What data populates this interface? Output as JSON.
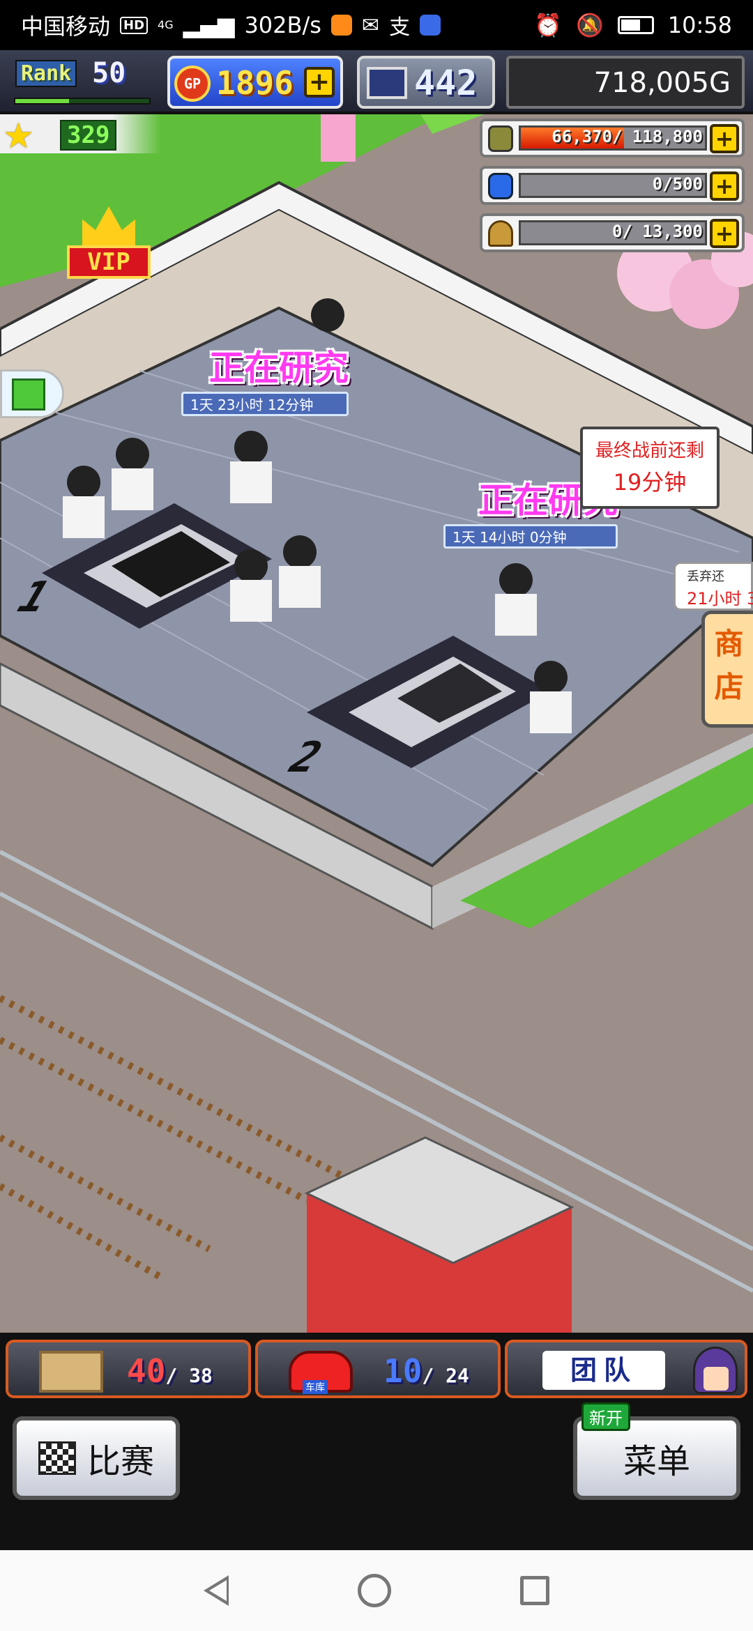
{
  "status_bar": {
    "carrier": "中国移动",
    "hd": "HD",
    "network": "4G",
    "speed": "302B/s",
    "time": "10:58"
  },
  "hud": {
    "rank_label": "Rank",
    "rank_value": "50",
    "rank_progress": 0.4,
    "gp_label": "GP",
    "gp_value": "1896",
    "research_points": "442",
    "money": "718,005G",
    "star_level": "329"
  },
  "resources": [
    {
      "icon": "fuel-barrel-icon",
      "text": "66,370/ 118,800",
      "fill": 0.56
    },
    {
      "icon": "bottle-icon",
      "text": "0/500",
      "fill": 0
    },
    {
      "icon": "wheat-icon",
      "text": "0/ 13,300",
      "fill": 0
    }
  ],
  "vip_label": "VIP",
  "research_labels": [
    {
      "title": "正在研究",
      "time": "1天 23小时 12分钟"
    },
    {
      "title": "正在研究",
      "time": "1天 14小时 0分钟"
    }
  ],
  "final_battle": {
    "line1": "最终战前还剩",
    "line2": "19分钟"
  },
  "discard_tag": {
    "line1": "丢弃还",
    "line2": "21小时 3"
  },
  "shop_label": "商店",
  "bay_numbers": [
    "1",
    "2"
  ],
  "bottom": {
    "cargo": {
      "current": "40",
      "max": "/ 38"
    },
    "garage": {
      "current": "10",
      "max": "/ 24",
      "label": "车库"
    },
    "team_label": "团队",
    "race_button": "比赛",
    "menu_button": "菜单",
    "new_tag": "新开"
  },
  "colors": {
    "hud_dark": "#2b2b2e",
    "gp_blue": "#2244c8",
    "research_pink": "#ff3af0",
    "alert_red": "#e02020",
    "floor_gray": "#8f95a8"
  }
}
